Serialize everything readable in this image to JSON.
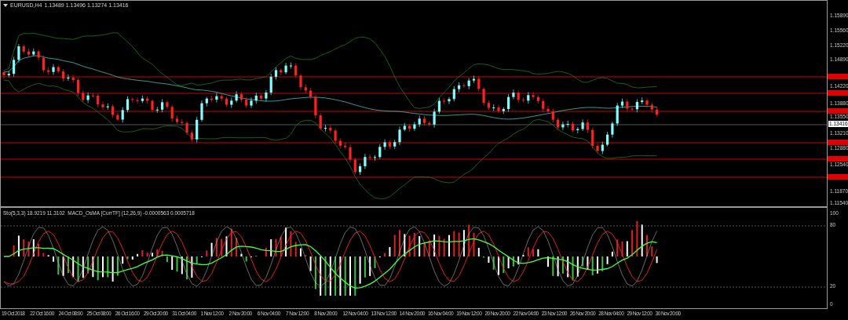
{
  "chart": {
    "symbol": "EURUSD,H4",
    "ohlc": "1.13489 1.13496 1.13274 1.13416"
  },
  "price_axis": {
    "labels": [
      "1.15890",
      "1.15560",
      "1.15220",
      "1.14890",
      "1.14220",
      "1.13880",
      "1.13550",
      "1.13210",
      "1.12880",
      "1.12540",
      "1.11870",
      "1.11540"
    ],
    "current_price": "1.13416"
  },
  "indicator": {
    "legend": "Sto(5,3,3) 18.9219 11.3102  MACD_OsMA [CurrTF] (12,26,9) -0.0000563 0.0005718",
    "axis_labels": [
      "100",
      "80",
      "20",
      "0"
    ]
  },
  "time_axis": {
    "labels": [
      "19 Oct 2018",
      "22 Oct 16:00",
      "24 Oct 08:00",
      "25 Oct 08:00",
      "26 Oct 16:00",
      "29 Oct 20:00",
      "31 Oct 04:00",
      "1 Nov 12:00",
      "2 Nov 20:00",
      "6 Nov 04:00",
      "7 Nov 12:00",
      "8 Nov 20:00",
      "12 Nov 04:00",
      "13 Nov 12:00",
      "14 Nov 20:00",
      "16 Nov 04:00",
      "19 Nov 12:00",
      "20 Nov 20:00",
      "22 Nov 04:00",
      "23 Nov 12:00",
      "26 Nov 20:00",
      "28 Nov 04:00",
      "29 Nov 12:00",
      "30 Nov 20:00"
    ]
  }
}
